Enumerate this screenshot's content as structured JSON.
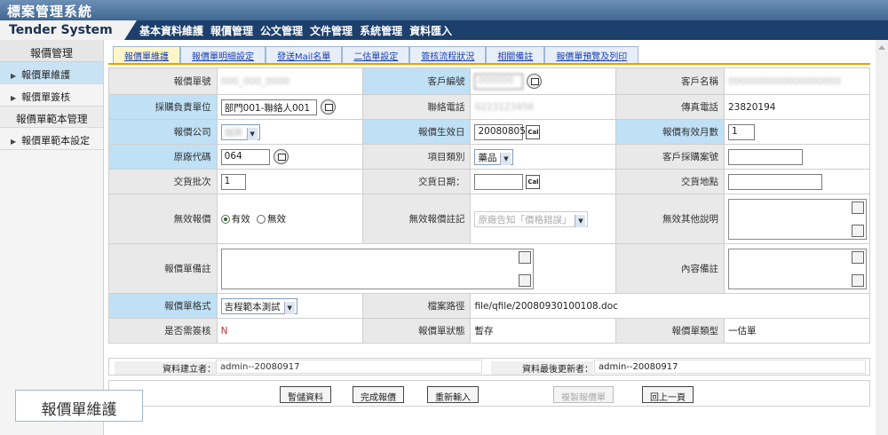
{
  "app": {
    "title": "標案管理系統",
    "brand": "Tender System",
    "menu": [
      "基本資料維護",
      "報價管理",
      "公文管理",
      "文件管理",
      "系統管理",
      "資料匯入"
    ]
  },
  "sidebar": {
    "header": "報價管理",
    "items": [
      "報價單維護",
      "報價單簽核"
    ],
    "group": "報價單範本管理",
    "group_items": [
      "報價單範本設定"
    ]
  },
  "tabs": [
    "報價單維護",
    "報價單明細設定",
    "發送Mail名單",
    "二估單設定",
    "簽核流程狀況",
    "相關備註",
    "報價單預覽及列印"
  ],
  "form": {
    "quote_no_label": "報價單號",
    "quote_no": "000_000_0000",
    "customer_no_label": "客戶編號",
    "customer_no": "000000",
    "customer_name_label": "客戶名稱",
    "customer_name": "0000000000000000000",
    "purchase_unit_label": "採購負責單位",
    "purchase_unit": "部門001-聯絡人001",
    "phone_label": "聯絡電話",
    "phone": "0223123456",
    "fax_label": "傳真電話",
    "fax": "23820194",
    "company_label": "報價公司",
    "company": "瑞昇",
    "effective_date_label": "報價生效日",
    "effective_date": "20080805",
    "valid_months_label": "報價有效月數",
    "valid_months": "1",
    "manufacturer_label": "原廠代碼",
    "manufacturer": "064",
    "item_type_label": "項目類別",
    "item_type": "藥品",
    "customer_case_label": "客戶採購案號",
    "customer_case": "",
    "batch_label": "交貨批次",
    "batch": "1",
    "delivery_date_label": "交貨日期：",
    "delivery_date": "",
    "delivery_place_label": "交貨地點",
    "delivery_place": "",
    "invalid_label": "無效報價",
    "radio_valid": "有效",
    "radio_invalid": "無效",
    "invalid_note_label": "無效報價註記",
    "invalid_note": "原廠告知「價格錯誤」",
    "invalid_other_label": "無效其他說明",
    "remark_label": "報價單備註",
    "content_note_label": "內容備註",
    "format_label": "報價單格式",
    "format": "吉程範本測試",
    "path_label": "檔案路徑",
    "path": "file/qfile/20080930100108.doc",
    "approval_label": "是否需簽核",
    "approval": "N",
    "status_label": "報價單狀態",
    "status": "暫存",
    "type_label": "報價單類型",
    "type": "一估單"
  },
  "meta": {
    "creator_label": "資料建立者：",
    "creator": "admin--20080917",
    "updater_label": "資料最後更新者：",
    "updater": "admin--20080917"
  },
  "actions": [
    "暫儲資料",
    "完成報價",
    "重新輸入",
    "複製報價單",
    "回上一頁"
  ],
  "caption": "報價單維護"
}
